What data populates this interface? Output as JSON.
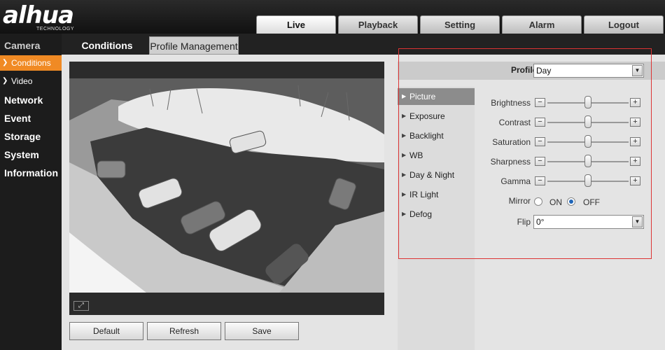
{
  "brand": {
    "name": "alhua",
    "subtitle": "TECHNOLOGY"
  },
  "topnav": [
    "Live",
    "Playback",
    "Setting",
    "Alarm",
    "Logout"
  ],
  "sidebar": {
    "camera": "Camera",
    "conditions": "Conditions",
    "video": "Video",
    "items": [
      "Network",
      "Event",
      "Storage",
      "System",
      "Information"
    ]
  },
  "tabs": {
    "conditions": "Conditions",
    "profile_management": "Profile Management"
  },
  "buttons": {
    "default": "Default",
    "refresh": "Refresh",
    "save": "Save"
  },
  "profile": {
    "label": "Profile",
    "value": "Day"
  },
  "menu": [
    "Picture",
    "Exposure",
    "Backlight",
    "WB",
    "Day & Night",
    "IR Light",
    "Defog"
  ],
  "sliders": [
    {
      "label": "Brightness",
      "level": 0.5
    },
    {
      "label": "Contrast",
      "level": 0.5
    },
    {
      "label": "Saturation",
      "level": 0.5
    },
    {
      "label": "Sharpness",
      "level": 0.5
    },
    {
      "label": "Gamma",
      "level": 0.5
    }
  ],
  "mirror": {
    "label": "Mirror",
    "on": "ON",
    "off": "OFF",
    "selected": "OFF"
  },
  "flip": {
    "label": "Flip",
    "value": "0°"
  },
  "colors": {
    "accent": "#f08a24",
    "highlight_border": "#dd3333",
    "menu_active": "#8c8c8c"
  }
}
